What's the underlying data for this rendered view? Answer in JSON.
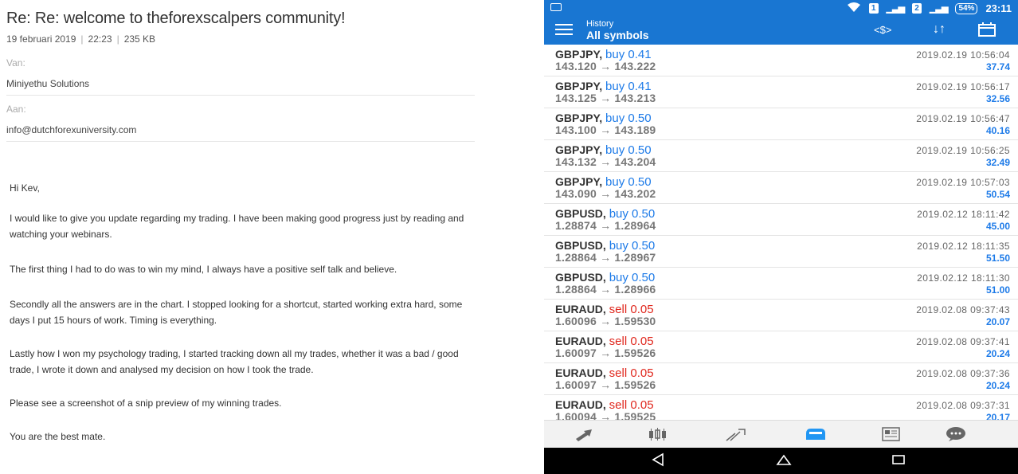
{
  "email": {
    "subject": "Re: Re: welcome to theforexscalpers community!",
    "date": "19 februari 2019",
    "time": "22:23",
    "size": "235 KB",
    "from_label": "Van:",
    "from_value": "Miniyethu Solutions",
    "to_label": "Aan:",
    "to_value": "info@dutchforexuniversity.com",
    "body": [
      "Hi Kev,",
      "I would like to give you update regarding my trading. I have been making good progress just by reading and watching your webinars.",
      "The first thing I had to do was to win my mind, I always have a positive self talk and believe.",
      "Secondly all the answers are in the chart. I stopped looking for a shortcut, started working extra hard, some days I put 15 hours of work. Timing is everything.",
      "Lastly how I won my psychology trading, I started tracking down all my trades, whether it was a bad / good trade, I wrote it down and analysed my decision on how I took the trade.",
      "Please see a screenshot of a snip preview of my winning trades.",
      "You are the best mate."
    ]
  },
  "phone": {
    "status": {
      "clock": "23:11",
      "battery": "54%",
      "sim1": "1",
      "sim2": "2"
    },
    "appbar": {
      "title_small": "History",
      "title_main": "All symbols"
    },
    "trades": [
      {
        "symbol": "GBPJPY,",
        "direction": "buy 0.41",
        "type": "buy",
        "open": "143.120",
        "close": "143.222",
        "time": "2019.02.19 10:56:04",
        "profit": "37.74"
      },
      {
        "symbol": "GBPJPY,",
        "direction": "buy 0.41",
        "type": "buy",
        "open": "143.125",
        "close": "143.213",
        "time": "2019.02.19 10:56:17",
        "profit": "32.56"
      },
      {
        "symbol": "GBPJPY,",
        "direction": "buy 0.50",
        "type": "buy",
        "open": "143.100",
        "close": "143.189",
        "time": "2019.02.19 10:56:47",
        "profit": "40.16"
      },
      {
        "symbol": "GBPJPY,",
        "direction": "buy 0.50",
        "type": "buy",
        "open": "143.132",
        "close": "143.204",
        "time": "2019.02.19 10:56:25",
        "profit": "32.49"
      },
      {
        "symbol": "GBPJPY,",
        "direction": "buy 0.50",
        "type": "buy",
        "open": "143.090",
        "close": "143.202",
        "time": "2019.02.19 10:57:03",
        "profit": "50.54"
      },
      {
        "symbol": "GBPUSD,",
        "direction": "buy 0.50",
        "type": "buy",
        "open": "1.28874",
        "close": "1.28964",
        "time": "2019.02.12 18:11:42",
        "profit": "45.00"
      },
      {
        "symbol": "GBPUSD,",
        "direction": "buy 0.50",
        "type": "buy",
        "open": "1.28864",
        "close": "1.28967",
        "time": "2019.02.12 18:11:35",
        "profit": "51.50"
      },
      {
        "symbol": "GBPUSD,",
        "direction": "buy 0.50",
        "type": "buy",
        "open": "1.28864",
        "close": "1.28966",
        "time": "2019.02.12 18:11:30",
        "profit": "51.00"
      },
      {
        "symbol": "EURAUD,",
        "direction": "sell 0.05",
        "type": "sell",
        "open": "1.60096",
        "close": "1.59530",
        "time": "2019.02.08 09:37:43",
        "profit": "20.07"
      },
      {
        "symbol": "EURAUD,",
        "direction": "sell 0.05",
        "type": "sell",
        "open": "1.60097",
        "close": "1.59526",
        "time": "2019.02.08 09:37:41",
        "profit": "20.24"
      },
      {
        "symbol": "EURAUD,",
        "direction": "sell 0.05",
        "type": "sell",
        "open": "1.60097",
        "close": "1.59526",
        "time": "2019.02.08 09:37:36",
        "profit": "20.24"
      },
      {
        "symbol": "EURAUD,",
        "direction": "sell 0.05",
        "type": "sell",
        "open": "1.60094",
        "close": "1.59525",
        "time": "2019.02.08 09:37:31",
        "profit": "20.17"
      }
    ],
    "arrow": "→",
    "tabs": [
      "quotes-icon",
      "chart-icon",
      "trade-icon",
      "history-icon",
      "news-icon",
      "chat-icon"
    ],
    "active_tab": "history-icon",
    "colors": {
      "accent": "#1976d2",
      "buy": "#1e7be8",
      "sell": "#e0281e"
    }
  }
}
